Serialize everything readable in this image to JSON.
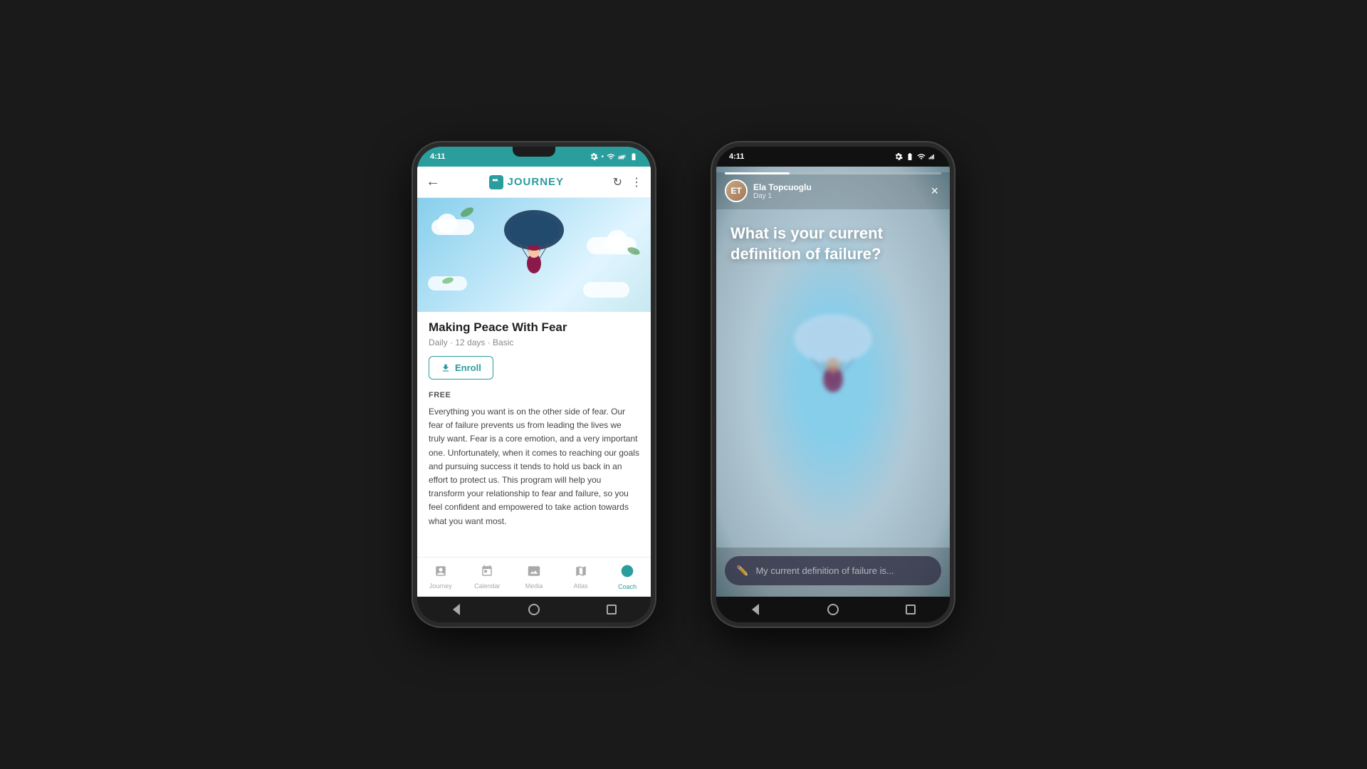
{
  "phone1": {
    "status_time": "4:11",
    "status_bar_color": "teal",
    "toolbar": {
      "back_label": "←",
      "title": "JOURNEY",
      "refresh_icon": "refresh",
      "more_icon": "more_vert"
    },
    "hero_alt": "Making Peace With Fear illustration",
    "course": {
      "title": "Making Peace With Fear",
      "meta": "Daily · 12 days · Basic",
      "enroll_label": "Enroll",
      "free_label": "FREE",
      "description": "Everything you want is on the other side of fear. Our fear of failure prevents us from leading the lives we truly want. Fear is a core emotion, and a very important one. Unfortunately, when it comes to reaching our goals and pursuing success it tends to hold us back in an effort to protect us. This program will help you transform your relationship to fear and failure, so you feel confident and empowered to take action towards what you want most."
    },
    "nav": {
      "items": [
        {
          "id": "journey",
          "label": "Journey",
          "icon": "📋",
          "active": false
        },
        {
          "id": "calendar",
          "label": "Calendar",
          "icon": "📅",
          "active": false
        },
        {
          "id": "media",
          "label": "Media",
          "icon": "🖼️",
          "active": false
        },
        {
          "id": "atlas",
          "label": "Atlas",
          "icon": "🗺️",
          "active": false
        },
        {
          "id": "coach",
          "label": "Coach",
          "icon": "🔵",
          "active": true
        }
      ]
    }
  },
  "phone2": {
    "status_time": "4:11",
    "status_bar_color": "black",
    "story": {
      "username": "Ela Topcuoglu",
      "day": "Day 1",
      "progress": 30,
      "question": "What is your current definition of failure?",
      "input_placeholder": "My current definition of failure is...",
      "close_icon": "×"
    }
  }
}
